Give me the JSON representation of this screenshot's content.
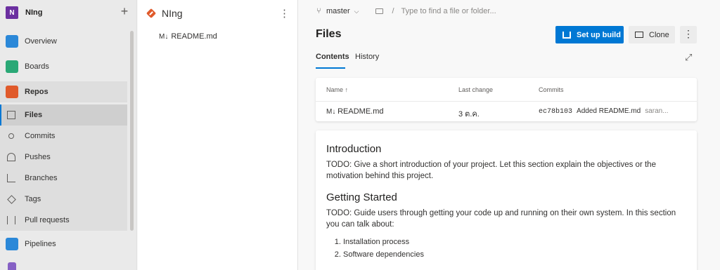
{
  "project": {
    "badge": "N",
    "name": "NIng"
  },
  "nav": {
    "items": [
      {
        "label": "Overview"
      },
      {
        "label": "Boards"
      },
      {
        "label": "Repos"
      },
      {
        "label": "Files"
      },
      {
        "label": "Commits"
      },
      {
        "label": "Pushes"
      },
      {
        "label": "Branches"
      },
      {
        "label": "Tags"
      },
      {
        "label": "Pull requests"
      },
      {
        "label": "Pipelines"
      }
    ]
  },
  "tree": {
    "repo_name": "NIng",
    "files": [
      {
        "name": "README.md"
      }
    ]
  },
  "toolbar": {
    "branch": "master",
    "path_placeholder": "Type to find a file or folder..."
  },
  "main": {
    "title": "Files",
    "setup_build_label": "Set up build",
    "clone_label": "Clone",
    "tabs": [
      {
        "label": "Contents"
      },
      {
        "label": "History"
      }
    ],
    "table": {
      "headers": {
        "name": "Name",
        "last_change": "Last change",
        "commits": "Commits"
      },
      "rows": [
        {
          "name": "README.md",
          "last_change": "3 ต.ค.",
          "commit_hash": "ec78b103",
          "commit_msg": "Added README.md",
          "author": "saran..."
        }
      ]
    }
  },
  "readme": {
    "h1": "Introduction",
    "p1": "TODO: Give a short introduction of your project. Let this section explain the objectives or the motivation behind this project.",
    "h2": "Getting Started",
    "p2": "TODO: Guide users through getting your code up and running on their own system. In this section you can talk about:",
    "list": [
      "Installation process",
      "Software dependencies"
    ]
  }
}
